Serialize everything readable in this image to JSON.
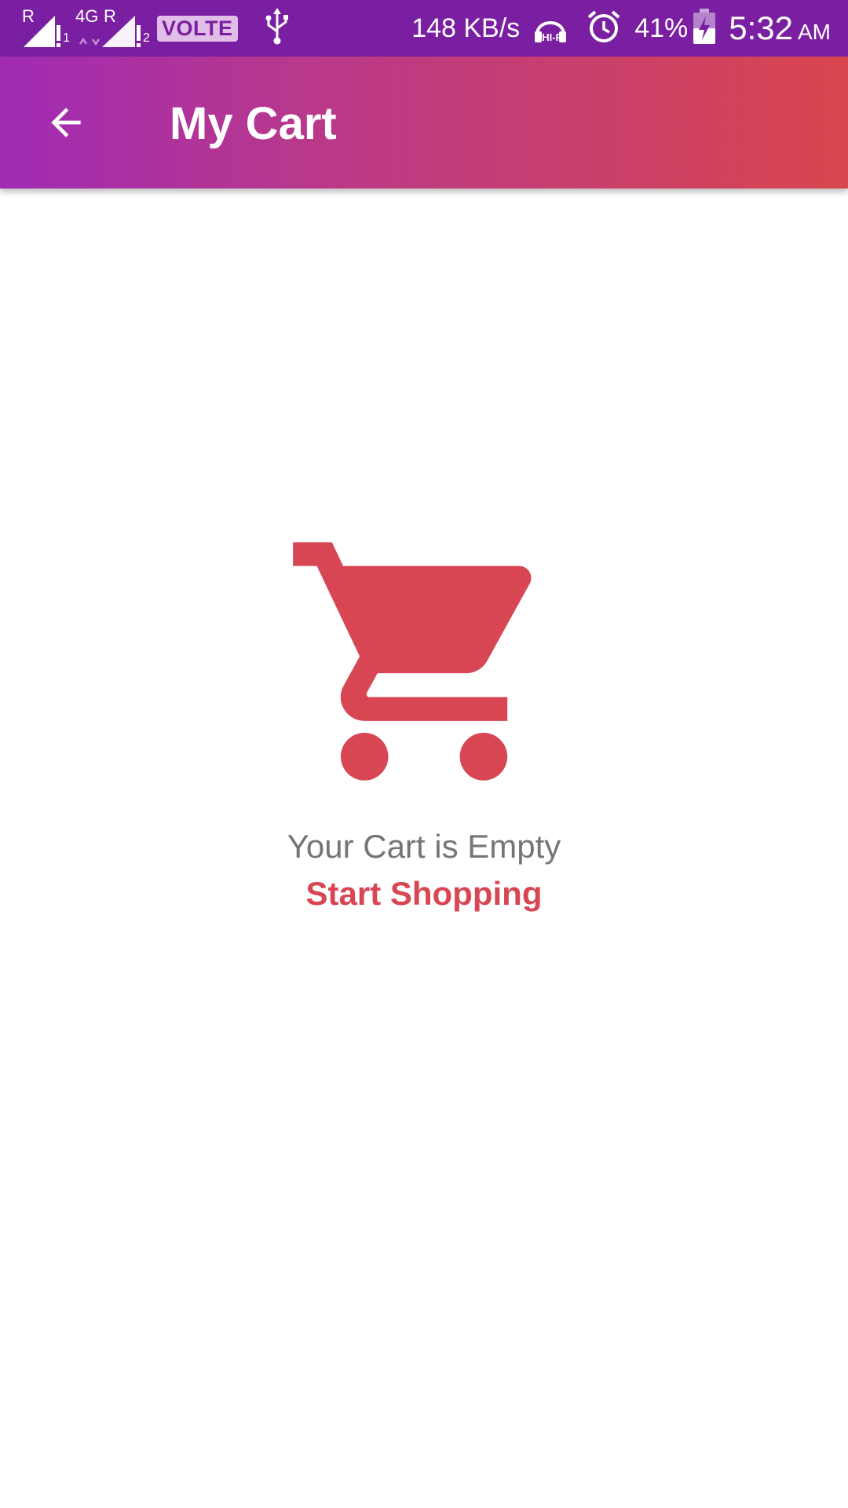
{
  "status_bar": {
    "sim1_roaming": "R",
    "sim1_slot": "1",
    "sim2_network": "4G",
    "sim2_roaming": "R",
    "sim2_slot": "2",
    "volte": "VOLTE",
    "net_speed": "148 KB/s",
    "hifi": "HI-FI",
    "battery": "41%",
    "time": "5:32",
    "ampm": "AM"
  },
  "app_bar": {
    "back_icon": "arrow-back-icon",
    "title": "My Cart",
    "gradient_start": "#a02bb4",
    "gradient_end": "#d9464e"
  },
  "empty_state": {
    "icon": "shopping-cart-icon",
    "icon_color": "#d84654",
    "message": "Your Cart is Empty",
    "link_label": "Start Shopping",
    "link_color": "#d84654"
  }
}
